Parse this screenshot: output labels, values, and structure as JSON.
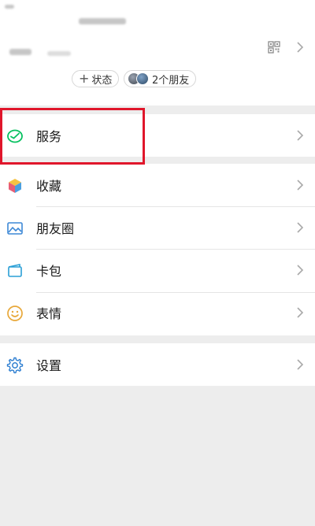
{
  "profile": {
    "status_button": "状态",
    "friends_count_label": "2个朋友"
  },
  "menu": {
    "services": "服务",
    "favorites": "收藏",
    "moments": "朋友圈",
    "cards": "卡包",
    "stickers": "表情",
    "settings": "设置"
  },
  "colors": {
    "highlight": "#e0162b",
    "background": "#ededed",
    "service_icon": "#07c160",
    "settings_icon": "#2f7fd1"
  }
}
